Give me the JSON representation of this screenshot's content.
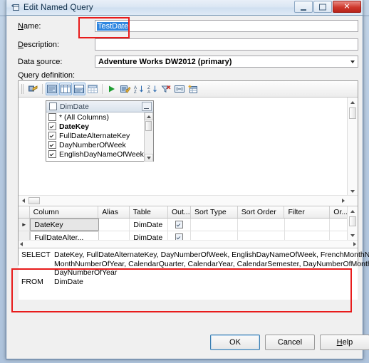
{
  "window": {
    "title": "Edit Named Query",
    "icon": "named-query-icon",
    "buttons": {
      "minimize": "–",
      "maximize": "□",
      "close": "✕"
    }
  },
  "form": {
    "name": {
      "label": "Name:",
      "label_accel": "N",
      "value": "TestDate",
      "selected": true
    },
    "description": {
      "label": "Description:",
      "label_accel": "D",
      "value": "",
      "placeholder": ""
    },
    "data_source": {
      "label": "Data source:",
      "label_accel": "s",
      "value": "Adventure Works DW2012 (primary)"
    },
    "query_definition_label": "Query definition:"
  },
  "toolbar": {
    "items": [
      {
        "name": "change-type-icon",
        "title": "Change Type",
        "pressed": false
      },
      {
        "name": "show-diagram-pane-icon",
        "title": "Diagram Pane",
        "pressed": true
      },
      {
        "name": "show-grid-pane-icon",
        "title": "Grid Pane",
        "pressed": true
      },
      {
        "name": "show-sql-pane-icon",
        "title": "SQL Pane",
        "pressed": true
      },
      {
        "name": "show-results-pane-icon",
        "title": "Results Pane",
        "pressed": false
      },
      {
        "name": "run-icon",
        "title": "Run",
        "pressed": false
      },
      {
        "name": "verify-sql-icon",
        "title": "Verify SQL Syntax",
        "pressed": false
      },
      {
        "name": "sort-ascending-icon",
        "title": "Sort Ascending",
        "pressed": false
      },
      {
        "name": "sort-descending-icon",
        "title": "Sort Descending",
        "pressed": false
      },
      {
        "name": "remove-filter-icon",
        "title": "Remove Filter",
        "pressed": false
      },
      {
        "name": "use-group-by-icon",
        "title": "Use Group By",
        "pressed": false
      },
      {
        "name": "add-table-icon",
        "title": "Add Table",
        "pressed": false
      }
    ]
  },
  "diagram": {
    "table": {
      "name": "DimDate",
      "columns": [
        {
          "label": "* (All Columns)",
          "checked": false,
          "bold": false
        },
        {
          "label": "DateKey",
          "checked": true,
          "bold": true
        },
        {
          "label": "FullDateAlternateKey",
          "checked": true,
          "bold": false
        },
        {
          "label": "DayNumberOfWeek",
          "checked": true,
          "bold": false
        },
        {
          "label": "EnglishDayNameOfWeek",
          "checked": true,
          "bold": false
        }
      ]
    }
  },
  "grid": {
    "headers": [
      "Column",
      "Alias",
      "Table",
      "Out...",
      "Sort Type",
      "Sort Order",
      "Filter",
      "Or..."
    ],
    "rows": [
      {
        "current": true,
        "column": "DateKey",
        "alias": "",
        "table": "DimDate",
        "output": true,
        "sort_type": "",
        "sort_order": "",
        "filter": "",
        "or": ""
      },
      {
        "current": false,
        "column": "FullDateAlter...",
        "alias": "",
        "table": "DimDate",
        "output": true,
        "sort_type": "",
        "sort_order": "",
        "filter": "",
        "or": ""
      }
    ]
  },
  "sql": {
    "lines": [
      {
        "keyword": "SELECT",
        "text": "DateKey, FullDateAlternateKey, DayNumberOfWeek, EnglishDayNameOfWeek, FrenchMonthName,"
      },
      {
        "keyword": "",
        "text": "MonthNumberOfYear, CalendarQuarter, CalendarYear, CalendarSemester, DayNumberOfMonth,"
      },
      {
        "keyword": "",
        "text": "DayNumberOfYear"
      },
      {
        "keyword": "FROM",
        "text": "DimDate"
      }
    ]
  },
  "footer": {
    "ok": "OK",
    "cancel": "Cancel",
    "help": "Help",
    "help_accel": "H"
  },
  "annotations": {
    "color": "#e81b1b",
    "regions": [
      "name-field-highlight",
      "sql-pane-highlight"
    ]
  }
}
